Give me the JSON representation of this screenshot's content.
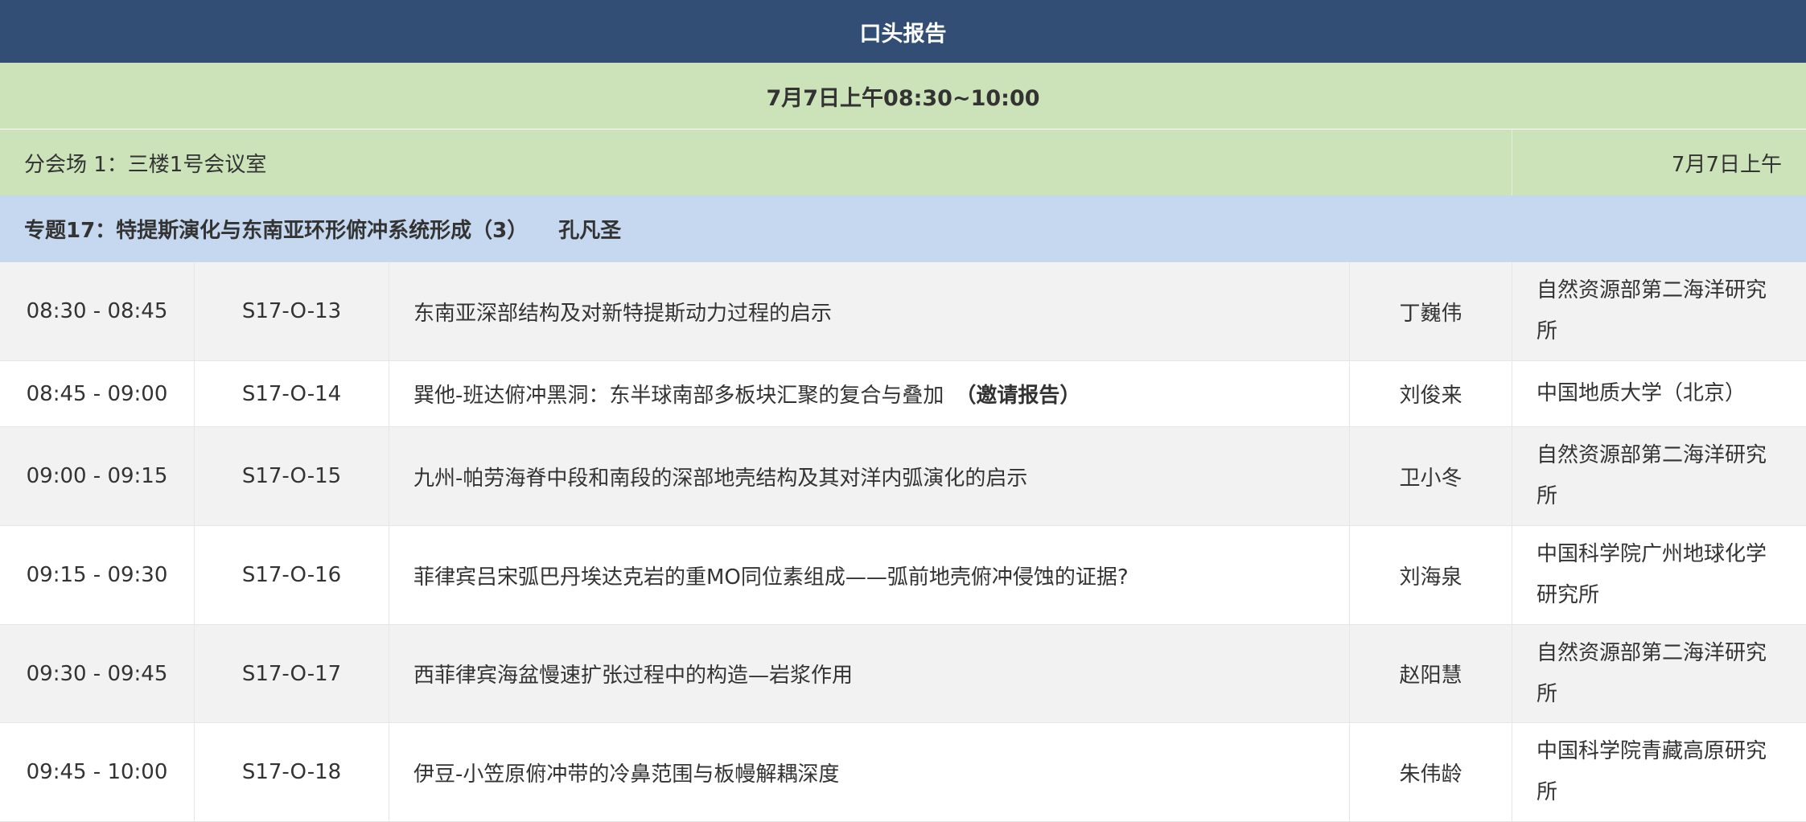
{
  "header": {
    "title": "口头报告"
  },
  "session": {
    "date_time": "7月7日上午08:30~10:00",
    "venue": "分会场 1：三楼1号会议室",
    "venue_date": "7月7日上午"
  },
  "topic": {
    "name": "专题17：特提斯演化与东南亚环形俯冲系统形成（3）",
    "chair": "孔凡圣"
  },
  "talks": [
    {
      "time": "08:30 - 08:45",
      "code": "S17-O-13",
      "title": "东南亚深部结构及对新特提斯动力过程的启示",
      "note": "",
      "speaker": "丁巍伟",
      "institution": "自然资源部第二海洋研究所"
    },
    {
      "time": "08:45 - 09:00",
      "code": "S17-O-14",
      "title": "巽他-班达俯冲黑洞：东半球南部多板块汇聚的复合与叠加",
      "note": "（邀请报告）",
      "speaker": "刘俊来",
      "institution": "中国地质大学（北京）"
    },
    {
      "time": "09:00 - 09:15",
      "code": "S17-O-15",
      "title": "九州-帕劳海脊中段和南段的深部地壳结构及其对洋内弧演化的启示",
      "note": "",
      "speaker": "卫小冬",
      "institution": "自然资源部第二海洋研究所"
    },
    {
      "time": "09:15 - 09:30",
      "code": "S17-O-16",
      "title": "菲律宾吕宋弧巴丹埃达克岩的重MO同位素组成——弧前地壳俯冲侵蚀的证据?",
      "note": "",
      "speaker": "刘海泉",
      "institution": "中国科学院广州地球化学研究所"
    },
    {
      "time": "09:30 - 09:45",
      "code": "S17-O-17",
      "title": "西菲律宾海盆慢速扩张过程中的构造—岩浆作用",
      "note": "",
      "speaker": "赵阳慧",
      "institution": "自然资源部第二海洋研究所"
    },
    {
      "time": "09:45 - 10:00",
      "code": "S17-O-18",
      "title": "伊豆-小笠原俯冲带的冷鼻范围与板幔解耦深度",
      "note": "",
      "speaker": "朱伟龄",
      "institution": "中国科学院青藏高原研究所"
    }
  ]
}
